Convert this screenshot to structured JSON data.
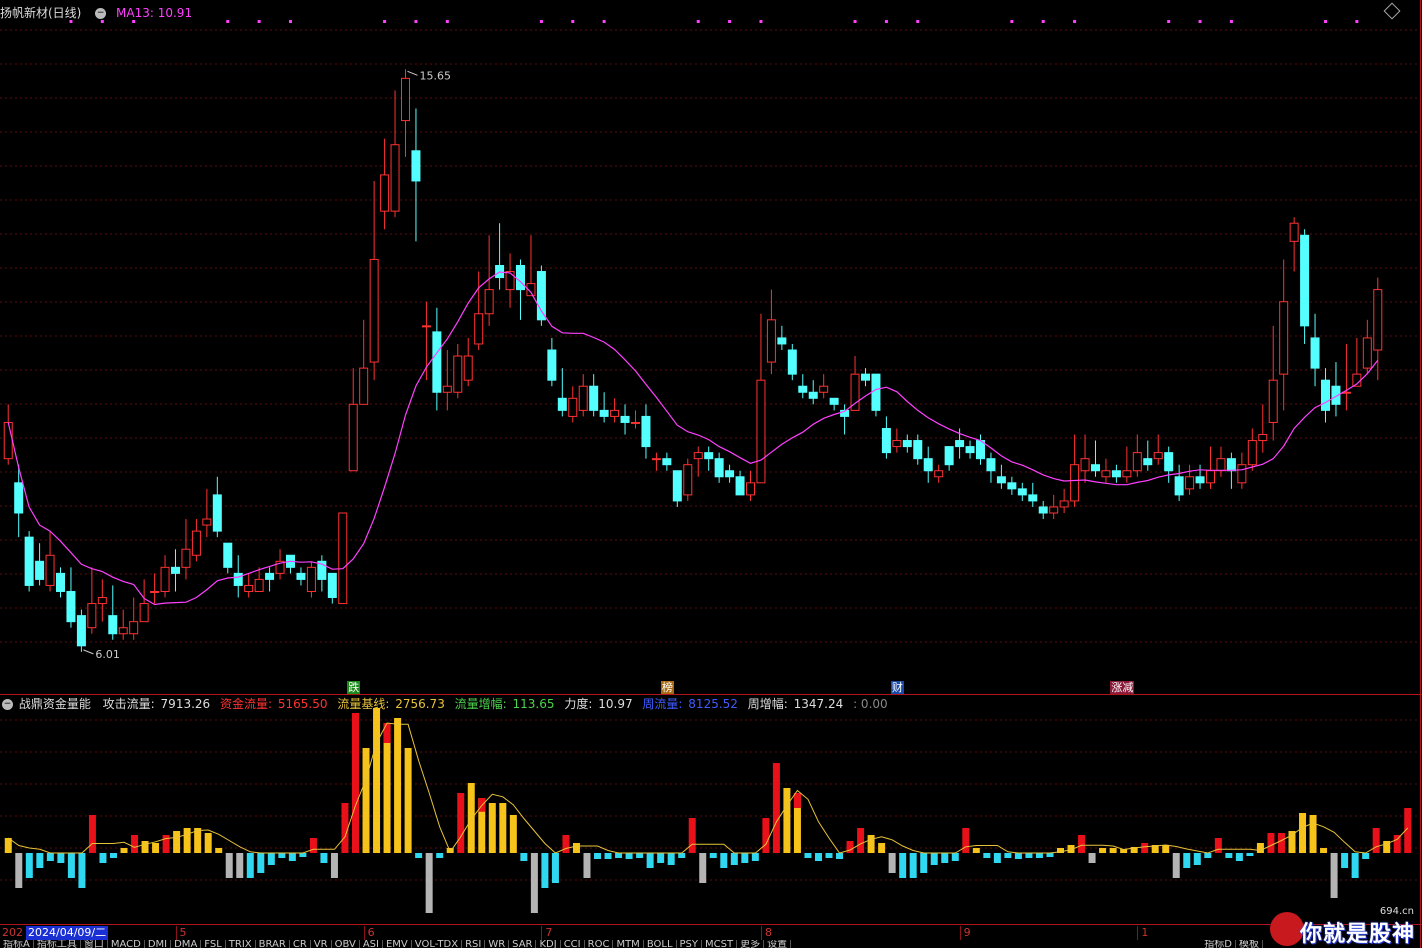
{
  "header": {
    "title": "扬帆新材(日线)",
    "ma_label": "MA13: 10.91"
  },
  "price_chart": {
    "high_label": "15.65",
    "low_label": "6.01",
    "up_color": "#ff3232",
    "down_color": "#54ffff",
    "ma_color": "#ff40ff",
    "ylim": [
      5.6,
      16.4
    ],
    "events": [
      {
        "label": "跌",
        "index": 33,
        "color": "#ffffff",
        "bg": "#1a8a1a"
      },
      {
        "label": "榜",
        "index": 63,
        "color": "#ffffff",
        "bg": "#a86a10"
      },
      {
        "label": "财",
        "index": 85,
        "color": "#ffffff",
        "bg": "#1a4aa8"
      },
      {
        "label": "涨减",
        "index": 106,
        "color": "#ffffff",
        "bg": "#8a1a3a"
      }
    ],
    "candles": [
      [
        9.2,
        9.8,
        9.1,
        10.1
      ],
      [
        8.8,
        8.3,
        7.9,
        9.1
      ],
      [
        7.9,
        7.1,
        7.0,
        8.0
      ],
      [
        7.5,
        7.2,
        7.1,
        7.8
      ],
      [
        7.1,
        7.6,
        7.0,
        8.0
      ],
      [
        7.3,
        7.0,
        6.9,
        7.4
      ],
      [
        7.0,
        6.5,
        6.4,
        7.4
      ],
      [
        6.6,
        6.1,
        6.0,
        6.7
      ],
      [
        6.4,
        6.8,
        6.3,
        7.4
      ],
      [
        6.8,
        6.9,
        6.5,
        7.2
      ],
      [
        6.6,
        6.3,
        6.2,
        7.1
      ],
      [
        6.3,
        6.4,
        6.2,
        6.7
      ],
      [
        6.3,
        6.5,
        6.2,
        6.9
      ],
      [
        6.5,
        6.8,
        6.5,
        7.2
      ],
      [
        7.0,
        7.0,
        6.8,
        7.3
      ],
      [
        7.0,
        7.4,
        6.9,
        7.6
      ],
      [
        7.4,
        7.3,
        7.0,
        7.7
      ],
      [
        7.4,
        7.7,
        7.2,
        8.2
      ],
      [
        7.6,
        8.0,
        7.5,
        8.2
      ],
      [
        8.1,
        8.2,
        7.9,
        8.7
      ],
      [
        8.6,
        8.0,
        7.9,
        8.9
      ],
      [
        7.8,
        7.4,
        7.3,
        7.8
      ],
      [
        7.3,
        7.1,
        6.9,
        7.6
      ],
      [
        7.0,
        7.1,
        6.9,
        7.3
      ],
      [
        7.0,
        7.2,
        7.0,
        7.4
      ],
      [
        7.3,
        7.2,
        7.0,
        7.4
      ],
      [
        7.3,
        7.5,
        7.2,
        7.7
      ],
      [
        7.6,
        7.4,
        7.3,
        7.6
      ],
      [
        7.3,
        7.2,
        7.1,
        7.4
      ],
      [
        7.0,
        7.4,
        6.9,
        7.5
      ],
      [
        7.5,
        7.2,
        7.0,
        7.6
      ],
      [
        7.3,
        6.9,
        6.8,
        7.3
      ],
      [
        6.8,
        8.3,
        6.8,
        8.3
      ],
      [
        9.0,
        10.1,
        9.0,
        10.7
      ],
      [
        10.1,
        10.7,
        10.1,
        11.5
      ],
      [
        10.8,
        12.5,
        10.5,
        13.8
      ],
      [
        13.3,
        13.9,
        13.0,
        14.5
      ],
      [
        13.3,
        14.4,
        13.2,
        15.3
      ],
      [
        14.8,
        15.5,
        14.2,
        15.65
      ],
      [
        14.3,
        13.8,
        12.8,
        15.0
      ],
      [
        11.4,
        11.4,
        10.5,
        11.8
      ],
      [
        11.3,
        10.3,
        10.0,
        11.7
      ],
      [
        10.3,
        10.4,
        10.0,
        11.0
      ],
      [
        10.3,
        10.9,
        10.2,
        11.1
      ],
      [
        10.5,
        10.9,
        10.4,
        11.2
      ],
      [
        11.1,
        11.6,
        11.0,
        12.3
      ],
      [
        11.6,
        12.0,
        11.4,
        12.9
      ],
      [
        12.4,
        12.2,
        12.0,
        13.1
      ],
      [
        12.0,
        12.3,
        11.7,
        12.6
      ],
      [
        12.4,
        12.0,
        11.5,
        12.5
      ],
      [
        11.9,
        12.1,
        11.9,
        12.9
      ],
      [
        12.3,
        11.5,
        11.4,
        12.4
      ],
      [
        11.0,
        10.5,
        10.4,
        11.2
      ],
      [
        10.2,
        10.0,
        9.9,
        10.7
      ],
      [
        9.9,
        10.2,
        9.8,
        10.4
      ],
      [
        10.0,
        10.4,
        9.9,
        10.6
      ],
      [
        10.4,
        10.0,
        9.9,
        10.6
      ],
      [
        10.0,
        9.9,
        9.8,
        10.3
      ],
      [
        9.9,
        10.0,
        9.8,
        10.2
      ],
      [
        9.9,
        9.8,
        9.6,
        10.1
      ],
      [
        9.8,
        9.8,
        9.7,
        10.0
      ],
      [
        9.9,
        9.4,
        9.2,
        10.1
      ],
      [
        9.2,
        9.2,
        9.0,
        9.3
      ],
      [
        9.2,
        9.1,
        9.0,
        9.3
      ],
      [
        9.0,
        8.5,
        8.4,
        9.0
      ],
      [
        8.6,
        9.1,
        8.5,
        9.2
      ],
      [
        9.2,
        9.3,
        8.9,
        9.4
      ],
      [
        9.3,
        9.2,
        9.0,
        9.4
      ],
      [
        9.2,
        8.9,
        8.8,
        9.3
      ],
      [
        9.0,
        8.9,
        8.8,
        9.1
      ],
      [
        8.9,
        8.6,
        8.6,
        9.0
      ],
      [
        8.6,
        8.8,
        8.5,
        9.0
      ],
      [
        8.8,
        10.5,
        8.8,
        11.6
      ],
      [
        10.8,
        11.5,
        10.6,
        12.0
      ],
      [
        11.2,
        11.1,
        11.0,
        11.4
      ],
      [
        11.0,
        10.6,
        10.5,
        11.1
      ],
      [
        10.4,
        10.3,
        10.2,
        10.6
      ],
      [
        10.3,
        10.2,
        10.1,
        10.5
      ],
      [
        10.3,
        10.4,
        10.2,
        10.6
      ],
      [
        10.2,
        10.1,
        10.0,
        10.2
      ],
      [
        10.0,
        9.9,
        9.6,
        10.1
      ],
      [
        10.0,
        10.6,
        10.0,
        10.9
      ],
      [
        10.6,
        10.5,
        10.4,
        10.7
      ],
      [
        10.6,
        10.0,
        9.9,
        10.6
      ],
      [
        9.7,
        9.3,
        9.2,
        9.9
      ],
      [
        9.4,
        9.5,
        9.3,
        9.7
      ],
      [
        9.5,
        9.4,
        9.3,
        9.6
      ],
      [
        9.5,
        9.2,
        9.1,
        9.6
      ],
      [
        9.2,
        9.0,
        8.8,
        9.4
      ],
      [
        8.9,
        9.0,
        8.8,
        9.1
      ],
      [
        9.4,
        9.1,
        9.0,
        9.4
      ],
      [
        9.5,
        9.4,
        9.2,
        9.7
      ],
      [
        9.4,
        9.3,
        9.2,
        9.5
      ],
      [
        9.5,
        9.2,
        9.1,
        9.6
      ],
      [
        9.2,
        9.0,
        8.8,
        9.3
      ],
      [
        8.9,
        8.8,
        8.7,
        9.1
      ],
      [
        8.8,
        8.7,
        8.6,
        8.9
      ],
      [
        8.7,
        8.6,
        8.5,
        8.8
      ],
      [
        8.6,
        8.5,
        8.4,
        8.8
      ],
      [
        8.4,
        8.3,
        8.2,
        8.5
      ],
      [
        8.3,
        8.4,
        8.2,
        8.6
      ],
      [
        8.4,
        8.5,
        8.3,
        8.7
      ],
      [
        8.5,
        9.1,
        8.4,
        9.6
      ],
      [
        9.0,
        9.2,
        8.8,
        9.6
      ],
      [
        9.1,
        9.0,
        8.9,
        9.5
      ],
      [
        8.9,
        9.0,
        8.8,
        9.2
      ],
      [
        9.0,
        8.9,
        8.8,
        9.1
      ],
      [
        8.9,
        9.0,
        8.8,
        9.4
      ],
      [
        9.0,
        9.3,
        8.9,
        9.6
      ],
      [
        9.2,
        9.1,
        9.0,
        9.5
      ],
      [
        9.2,
        9.3,
        9.1,
        9.6
      ],
      [
        9.3,
        9.0,
        8.8,
        9.4
      ],
      [
        8.9,
        8.6,
        8.5,
        9.1
      ],
      [
        8.7,
        8.9,
        8.6,
        9.1
      ],
      [
        8.9,
        8.8,
        8.7,
        9.1
      ],
      [
        8.8,
        9.0,
        8.7,
        9.4
      ],
      [
        9.0,
        9.2,
        8.9,
        9.4
      ],
      [
        9.2,
        9.0,
        8.7,
        9.3
      ],
      [
        8.8,
        9.1,
        8.7,
        9.3
      ],
      [
        9.1,
        9.5,
        9.0,
        9.7
      ],
      [
        9.5,
        9.6,
        9.3,
        10.1
      ],
      [
        9.8,
        10.5,
        9.5,
        11.4
      ],
      [
        10.6,
        11.8,
        10.0,
        12.5
      ],
      [
        12.8,
        13.1,
        12.3,
        13.2
      ],
      [
        12.9,
        11.4,
        11.1,
        13.0
      ],
      [
        11.2,
        10.7,
        10.4,
        11.6
      ],
      [
        10.5,
        10.0,
        9.8,
        10.7
      ],
      [
        10.4,
        10.1,
        9.9,
        10.8
      ],
      [
        10.3,
        10.3,
        10.0,
        11.1
      ],
      [
        10.4,
        10.6,
        10.4,
        11.2
      ],
      [
        10.7,
        11.2,
        10.6,
        11.5
      ],
      [
        11.0,
        12.0,
        10.5,
        12.2
      ]
    ]
  },
  "indicator": {
    "title": "战鼎资金量能",
    "attack_label": "攻击流量:",
    "attack_value": "7913.26",
    "fund_label": "资金流量:",
    "fund_value": "5165.50",
    "base_label": "流量基线:",
    "base_value": "2756.73",
    "growth_label": "流量增幅:",
    "growth_value": "113.65",
    "force_label": "力度:",
    "force_value": "10.97",
    "week_label": "周流量:",
    "week_value": "8125.52",
    "week_growth_label": "周增幅:",
    "week_growth_value": "1347.24",
    "tail_value": ": 0.00",
    "bars": [
      [
        0.15,
        "y"
      ],
      [
        -0.35,
        "g"
      ],
      [
        -0.25,
        "c"
      ],
      [
        -0.15,
        "c"
      ],
      [
        -0.08,
        "c"
      ],
      [
        -0.1,
        "c"
      ],
      [
        -0.25,
        "c"
      ],
      [
        -0.35,
        "c"
      ],
      [
        0.38,
        "r"
      ],
      [
        -0.1,
        "c"
      ],
      [
        -0.05,
        "c"
      ],
      [
        0.05,
        "y"
      ],
      [
        0.18,
        "r"
      ],
      [
        0.12,
        "y"
      ],
      [
        0.1,
        "y"
      ],
      [
        0.18,
        "r"
      ],
      [
        0.22,
        "y"
      ],
      [
        0.25,
        "y"
      ],
      [
        0.25,
        "y"
      ],
      [
        0.2,
        "y"
      ],
      [
        0.05,
        "y"
      ],
      [
        -0.25,
        "g"
      ],
      [
        -0.25,
        "g"
      ],
      [
        -0.25,
        "c"
      ],
      [
        -0.2,
        "c"
      ],
      [
        -0.12,
        "c"
      ],
      [
        -0.05,
        "c"
      ],
      [
        -0.08,
        "c"
      ],
      [
        -0.04,
        "c"
      ],
      [
        0.15,
        "r"
      ],
      [
        -0.1,
        "c"
      ],
      [
        -0.25,
        "g"
      ],
      [
        0.5,
        "r"
      ],
      [
        1.4,
        "r"
      ],
      [
        1.05,
        "y"
      ],
      [
        1.45,
        "y"
      ],
      [
        1.3,
        "y"
      ],
      [
        1.35,
        "y"
      ],
      [
        1.05,
        "y"
      ],
      [
        -0.05,
        "c"
      ],
      [
        -0.6,
        "g"
      ],
      [
        -0.05,
        "c"
      ],
      [
        0.05,
        "y"
      ],
      [
        0.6,
        "r"
      ],
      [
        0.7,
        "y"
      ],
      [
        0.55,
        "y"
      ],
      [
        0.5,
        "y"
      ],
      [
        0.5,
        "y"
      ],
      [
        0.38,
        "y"
      ],
      [
        -0.08,
        "c"
      ],
      [
        -0.6,
        "g"
      ],
      [
        -0.35,
        "c"
      ],
      [
        -0.3,
        "c"
      ],
      [
        0.18,
        "r"
      ],
      [
        0.1,
        "y"
      ],
      [
        -0.25,
        "g"
      ],
      [
        -0.06,
        "c"
      ],
      [
        -0.06,
        "c"
      ],
      [
        -0.05,
        "c"
      ],
      [
        -0.06,
        "c"
      ],
      [
        -0.05,
        "c"
      ],
      [
        -0.15,
        "c"
      ],
      [
        -0.1,
        "c"
      ],
      [
        -0.12,
        "c"
      ],
      [
        -0.05,
        "c"
      ],
      [
        0.35,
        "r"
      ],
      [
        -0.3,
        "g"
      ],
      [
        -0.05,
        "c"
      ],
      [
        -0.15,
        "c"
      ],
      [
        -0.12,
        "c"
      ],
      [
        -0.1,
        "c"
      ],
      [
        -0.08,
        "c"
      ],
      [
        0.35,
        "r"
      ],
      [
        0.9,
        "r"
      ],
      [
        0.65,
        "y"
      ],
      [
        0.6,
        "y"
      ],
      [
        -0.05,
        "c"
      ],
      [
        -0.08,
        "c"
      ],
      [
        -0.05,
        "c"
      ],
      [
        -0.06,
        "c"
      ],
      [
        0.12,
        "r"
      ],
      [
        0.25,
        "r"
      ],
      [
        0.18,
        "y"
      ],
      [
        0.1,
        "y"
      ],
      [
        -0.2,
        "g"
      ],
      [
        -0.25,
        "c"
      ],
      [
        -0.25,
        "c"
      ],
      [
        -0.2,
        "c"
      ],
      [
        -0.12,
        "c"
      ],
      [
        -0.1,
        "c"
      ],
      [
        -0.08,
        "c"
      ],
      [
        0.25,
        "r"
      ],
      [
        0.05,
        "y"
      ],
      [
        -0.05,
        "c"
      ],
      [
        -0.1,
        "c"
      ],
      [
        -0.05,
        "c"
      ],
      [
        -0.06,
        "c"
      ],
      [
        -0.05,
        "c"
      ],
      [
        -0.05,
        "c"
      ],
      [
        -0.04,
        "c"
      ],
      [
        0.05,
        "y"
      ],
      [
        0.08,
        "y"
      ],
      [
        0.18,
        "r"
      ],
      [
        -0.1,
        "g"
      ],
      [
        0.05,
        "y"
      ],
      [
        0.05,
        "y"
      ],
      [
        0.04,
        "y"
      ],
      [
        0.06,
        "y"
      ],
      [
        0.1,
        "r"
      ],
      [
        0.08,
        "y"
      ],
      [
        0.08,
        "y"
      ],
      [
        -0.25,
        "g"
      ],
      [
        -0.15,
        "c"
      ],
      [
        -0.12,
        "c"
      ],
      [
        -0.05,
        "c"
      ],
      [
        0.15,
        "r"
      ],
      [
        -0.05,
        "c"
      ],
      [
        -0.08,
        "c"
      ],
      [
        -0.03,
        "c"
      ],
      [
        0.1,
        "y"
      ],
      [
        0.2,
        "r"
      ],
      [
        0.2,
        "r"
      ],
      [
        0.22,
        "y"
      ],
      [
        0.4,
        "y"
      ],
      [
        0.38,
        "y"
      ],
      [
        0.05,
        "y"
      ],
      [
        -0.45,
        "g"
      ],
      [
        -0.15,
        "c"
      ],
      [
        -0.25,
        "c"
      ],
      [
        -0.06,
        "c"
      ],
      [
        0.25,
        "r"
      ],
      [
        0.12,
        "y"
      ],
      [
        0.18,
        "r"
      ],
      [
        0.45,
        "r"
      ]
    ]
  },
  "date_axis": {
    "cursor_date": "2024/04/09/二",
    "year_prefix": "202",
    "months": [
      {
        "label": "5",
        "index": 16
      },
      {
        "label": "6",
        "index": 34
      },
      {
        "label": "7",
        "index": 51
      },
      {
        "label": "8",
        "index": 72
      },
      {
        "label": "9",
        "index": 91
      },
      {
        "label": "1",
        "index": 108
      }
    ]
  },
  "tabs": [
    "指标A",
    "指标工具",
    "窗口",
    "MACD",
    "DMI",
    "DMA",
    "FSL",
    "TRIX",
    "BRAR",
    "CR",
    "VR",
    "OBV",
    "ASI",
    "EMV",
    "VOL-TDX",
    "RSI",
    "WR",
    "SAR",
    "KDJ",
    "CCI",
    "ROC",
    "MTM",
    "BOLL",
    "PSY",
    "MCST",
    "更多",
    "设置"
  ],
  "right_tabs": [
    "指标D",
    "模板"
  ],
  "logo": {
    "text": "你就是股神",
    "url": "694.cn"
  }
}
